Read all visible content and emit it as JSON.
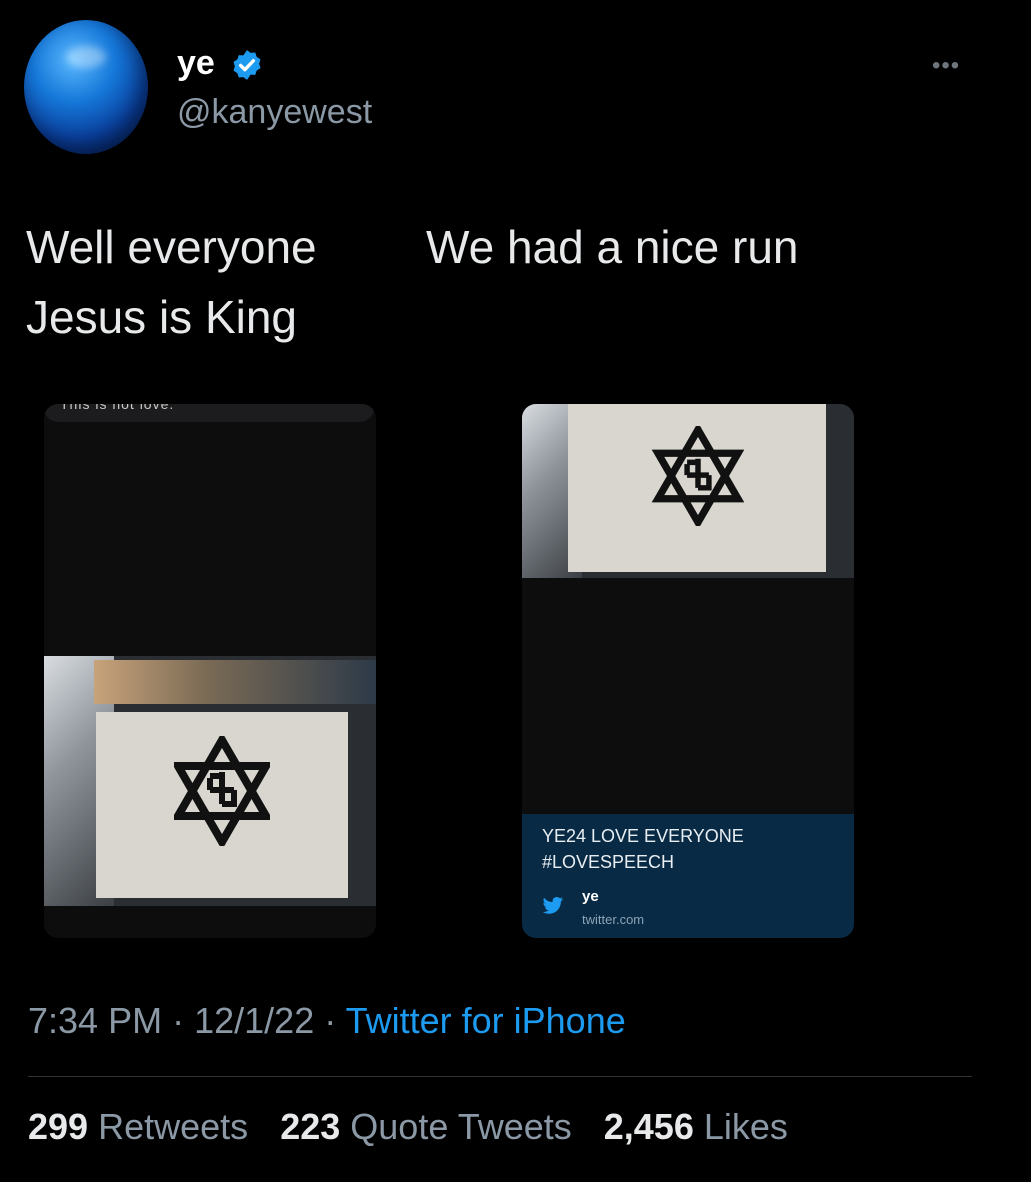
{
  "author": {
    "display_name": "ye",
    "handle": "@kanyewest",
    "avatar_icon": "globe-avatar",
    "verified_icon": "verified-badge-icon",
    "verified_color": "#1d9bf0"
  },
  "tweet": {
    "text_line_1": "Well everyone",
    "text_line_2": "We had a nice run",
    "text_line_3": "Jesus is King"
  },
  "media": {
    "left_image_caption_fragment": "This is not love.",
    "right_card": {
      "line1": "YE24 LOVE EVERYONE",
      "line2": "#LOVESPEECH",
      "name": "ye",
      "domain": "twitter.com",
      "icon": "twitter-bird-icon"
    }
  },
  "meta": {
    "time": "7:34 PM",
    "date": "12/1/22",
    "separator": "·",
    "source": "Twitter for iPhone"
  },
  "stats": {
    "retweets_count": "299",
    "retweets_label": "Retweets",
    "quotes_count": "223",
    "quotes_label": "Quote Tweets",
    "likes_count": "2,456",
    "likes_label": "Likes"
  },
  "colors": {
    "background": "#000000",
    "link": "#1d9bf0",
    "muted": "#8b98a5",
    "card_bg": "#082a44"
  }
}
